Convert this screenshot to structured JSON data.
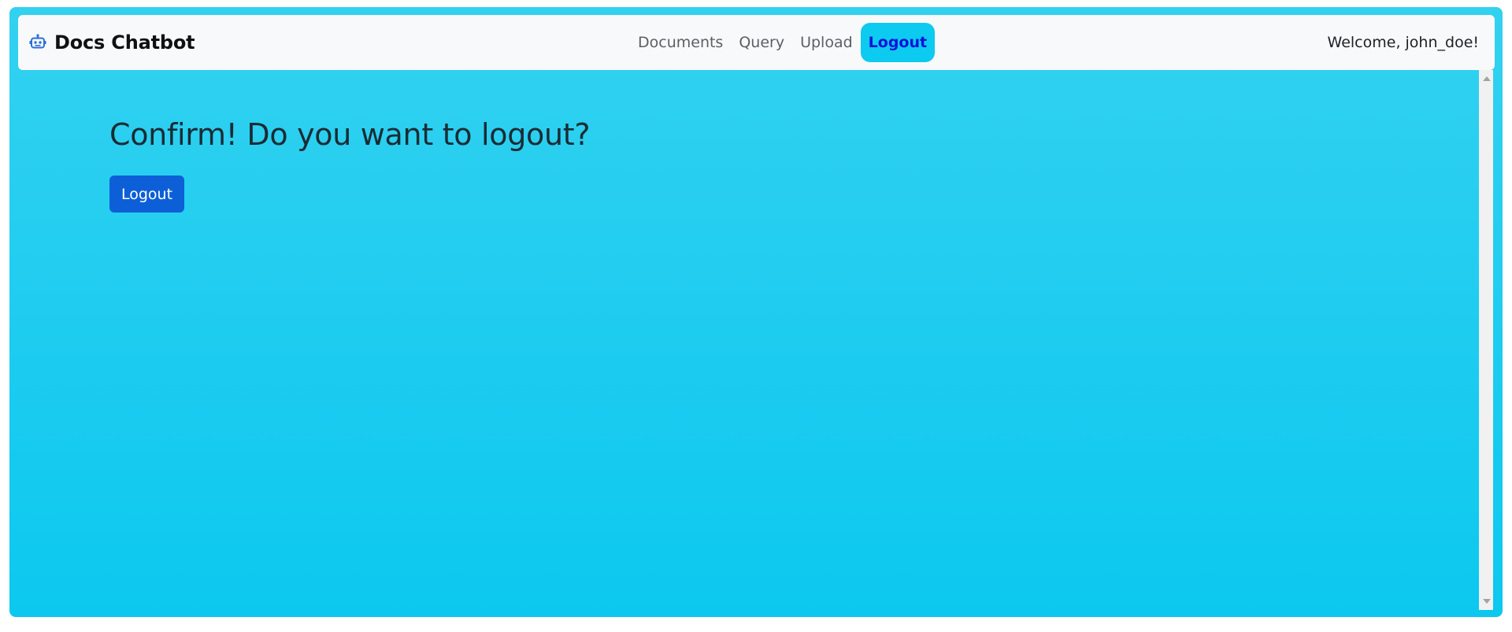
{
  "navbar": {
    "brand_icon": "robot-icon",
    "brand_title": "Docs Chatbot",
    "items": [
      {
        "label": "Documents"
      },
      {
        "label": "Query"
      },
      {
        "label": "Upload"
      },
      {
        "label": "Logout",
        "active": true
      }
    ],
    "welcome": "Welcome, john_doe!"
  },
  "main": {
    "heading": "Confirm! Do you want to logout?",
    "logout_label": "Logout"
  },
  "colors": {
    "background": "#0dcaf0",
    "navbar_bg": "#f8f9fa",
    "active_tab_bg": "#0dcaf0",
    "active_tab_text": "#0a12d8",
    "primary_button": "#0d5fd8"
  }
}
